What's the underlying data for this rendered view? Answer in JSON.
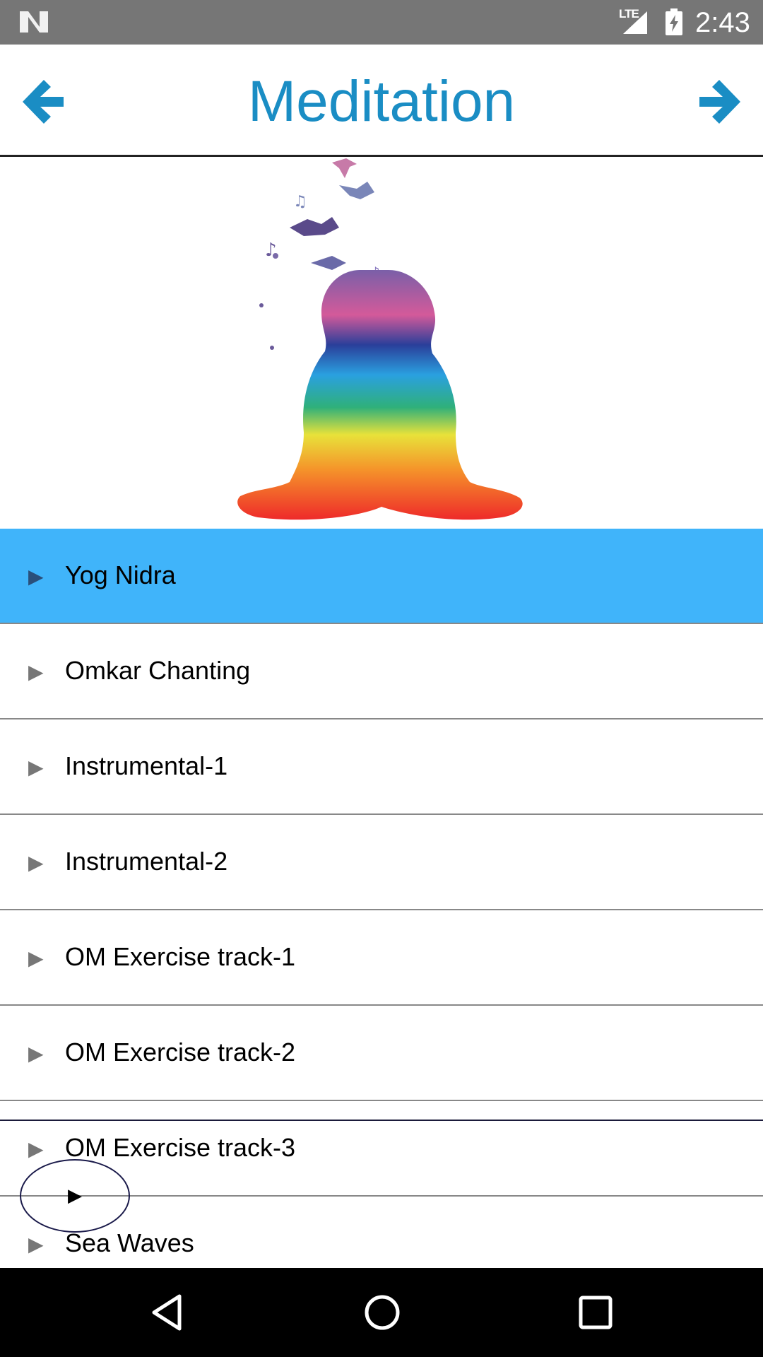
{
  "status_bar": {
    "network_label": "LTE",
    "time": "2:43"
  },
  "app_bar": {
    "title": "Meditation",
    "title_color": "#1a8dc4"
  },
  "tracks": [
    {
      "label": "Yog Nidra",
      "active": true
    },
    {
      "label": "Omkar Chanting",
      "active": false
    },
    {
      "label": "Instrumental-1",
      "active": false
    },
    {
      "label": "Instrumental-2",
      "active": false
    },
    {
      "label": "OM Exercise track-1",
      "active": false
    },
    {
      "label": "OM Exercise track-2",
      "active": false
    },
    {
      "label": "OM Exercise track-3",
      "active": false
    },
    {
      "label": "Sea Waves",
      "active": false
    }
  ],
  "colors": {
    "status_bar": "#767676",
    "active_track": "#40b4fa",
    "nav_bar": "#000000"
  },
  "icons": {
    "back": "arrow-left-icon",
    "forward": "arrow-right-icon",
    "track": "play-icon"
  }
}
